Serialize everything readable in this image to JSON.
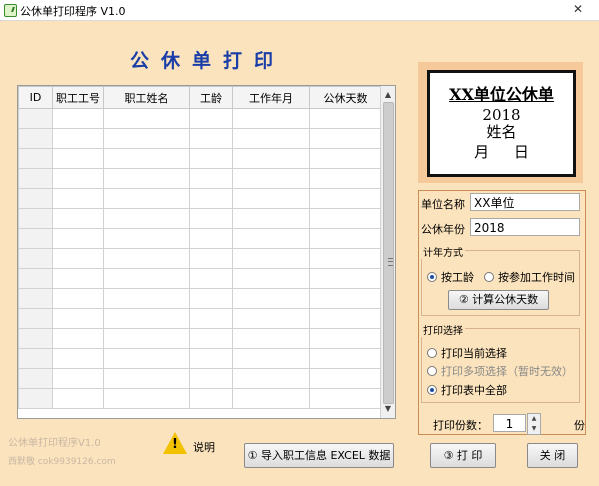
{
  "window": {
    "title": "公休单打印程序 V1.0",
    "close_glyph": "✕"
  },
  "main": {
    "title": "公休单打印"
  },
  "grid": {
    "columns": [
      "ID",
      "职工工号",
      "职工姓名",
      "工龄",
      "工作年月",
      "公休天数"
    ],
    "row_count": 15
  },
  "preview": {
    "title": "XX单位公休单",
    "year": "2018",
    "name": "姓名",
    "month_day": "月 日"
  },
  "form": {
    "unit_label": "单位名称",
    "unit_value": "XX单位",
    "year_label": "公休年份",
    "year_value": "2018",
    "calc_group_title": "计年方式",
    "radio_seniority": "按工龄",
    "radio_work_date": "按参加工作时间",
    "calc_button": "② 计算公休天数",
    "print_group_title": "打印选择",
    "print_current": "打印当前选择",
    "print_multi": "打印多项选择（暂时无效）",
    "print_all": "打印表中全部",
    "copies_label": "打印份数：",
    "copies_value": "1",
    "copies_unit": "份"
  },
  "footer": {
    "help_label": "说明",
    "import_button": "① 导入职工信息 EXCEL 数据",
    "print_button": "③ 打 印",
    "close_button": "关 闭",
    "watermark_line1": "公休单打印程序V1.0",
    "watermark_line2": "西默敬 cok9939126.com"
  },
  "colors": {
    "window_bg": "#fbe3bd",
    "title_blue": "#1a3ea8",
    "panel_border": "#c98c52"
  }
}
